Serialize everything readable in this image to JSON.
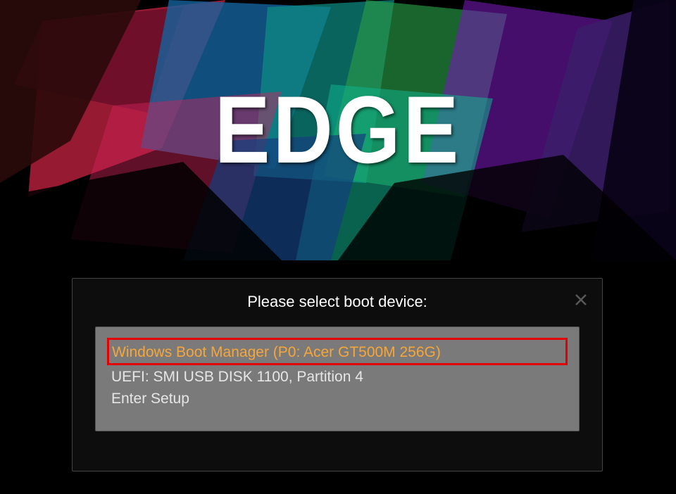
{
  "brand": {
    "logo_text": "EDGE"
  },
  "dialog": {
    "title": "Please select boot device:",
    "items": [
      {
        "label": "Windows Boot Manager (P0: Acer GT500M 256G)",
        "selected": true
      },
      {
        "label": "UEFI: SMI USB DISK 1100, Partition 4",
        "selected": false
      },
      {
        "label": "Enter Setup",
        "selected": false
      }
    ]
  }
}
